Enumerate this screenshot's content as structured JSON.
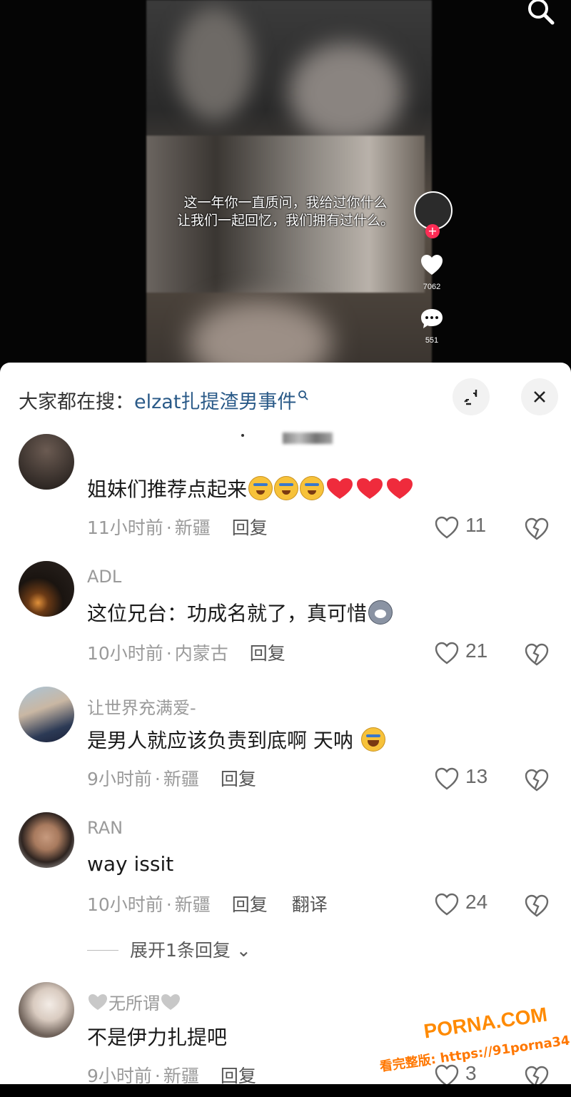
{
  "video": {
    "caption_line1": "这一年你一直质问，我给过你什么",
    "caption_line2": "让我们一起回忆，我们拥有过什么。",
    "like_count": "7062",
    "comment_count": "551",
    "icons": [
      "search-icon",
      "heart-icon",
      "comment-icon",
      "follow-plus-icon"
    ]
  },
  "panel": {
    "search_prefix": "大家都在搜：",
    "search_term": "elzat扎提渣男事件",
    "icons": [
      "mini-search-icon",
      "collapse-icon",
      "close-icon"
    ]
  },
  "comments": [
    {
      "name": "",
      "text": "姐妹们推荐点起来",
      "emojis": [
        "cry",
        "cry",
        "cry",
        "heart",
        "heart",
        "heart"
      ],
      "time": "11小时前",
      "location": "新疆",
      "reply": "回复",
      "likes": "11"
    },
    {
      "name": "ADL",
      "text": "这位兄台：功成名就了，真可惜",
      "emojis": [
        "husky"
      ],
      "time": "10小时前",
      "location": "内蒙古",
      "reply": "回复",
      "likes": "21"
    },
    {
      "name": "让世界充满爱-",
      "text": "是男人就应该负责到底啊 天呐",
      "emojis": [
        "laugh"
      ],
      "time": "9小时前",
      "location": "新疆",
      "reply": "回复",
      "likes": "13"
    },
    {
      "name": "RAN",
      "text": "way issit",
      "emojis": [],
      "time": "10小时前",
      "location": "新疆",
      "reply": "回复",
      "translate": "翻译",
      "likes": "24",
      "expand": "展开1条回复"
    },
    {
      "name": "无所谓",
      "text": "不是伊力扎提吧",
      "emojis": [],
      "time": "9小时前",
      "location": "新疆",
      "reply": "回复",
      "likes": "3"
    }
  ],
  "meta_separator": "·",
  "watermark": {
    "logo": "PORNA.COM",
    "url": "看完整版: https://91porna34.com"
  },
  "colors": {
    "accent_red": "#fe2c55",
    "search_term": "#2a5a88",
    "meta_gray": "#9a9a9a"
  }
}
